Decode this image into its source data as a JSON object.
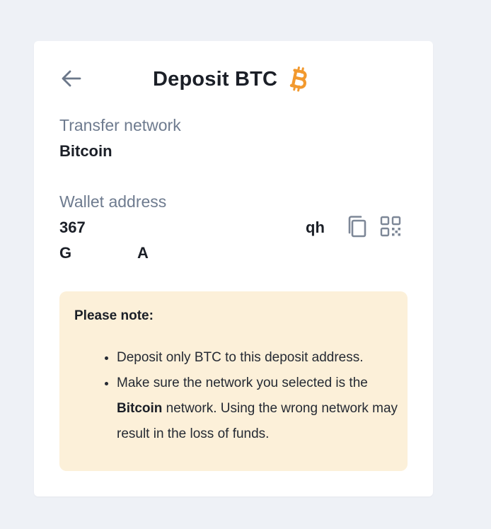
{
  "header": {
    "title": "Deposit BTC",
    "back_icon": "arrow-left-icon",
    "coin_icon": "bitcoin-logo-icon"
  },
  "network": {
    "label": "Transfer network",
    "value": "Bitcoin"
  },
  "wallet": {
    "label": "Wallet address",
    "address_line1_start": "367",
    "address_line1_end": "qh",
    "address_line2_start": "G",
    "address_line2_end": "A",
    "copy_icon": "copy-icon",
    "qr_icon": "qr-code-icon"
  },
  "note": {
    "title": "Please note:",
    "item1": "Deposit only BTC to this deposit address.",
    "item2_before": "Make sure the network you selected is the ",
    "item2_bold": "Bitcoin",
    "item2_after": " network. Using the wrong network may result in the loss of funds."
  },
  "colors": {
    "page_bg": "#eef1f6",
    "card_bg": "#ffffff",
    "note_bg": "#fcf0d9",
    "bitcoin_orange": "#f2992e",
    "muted_text": "#6e7b8f",
    "icon_gray": "#7d8797"
  }
}
